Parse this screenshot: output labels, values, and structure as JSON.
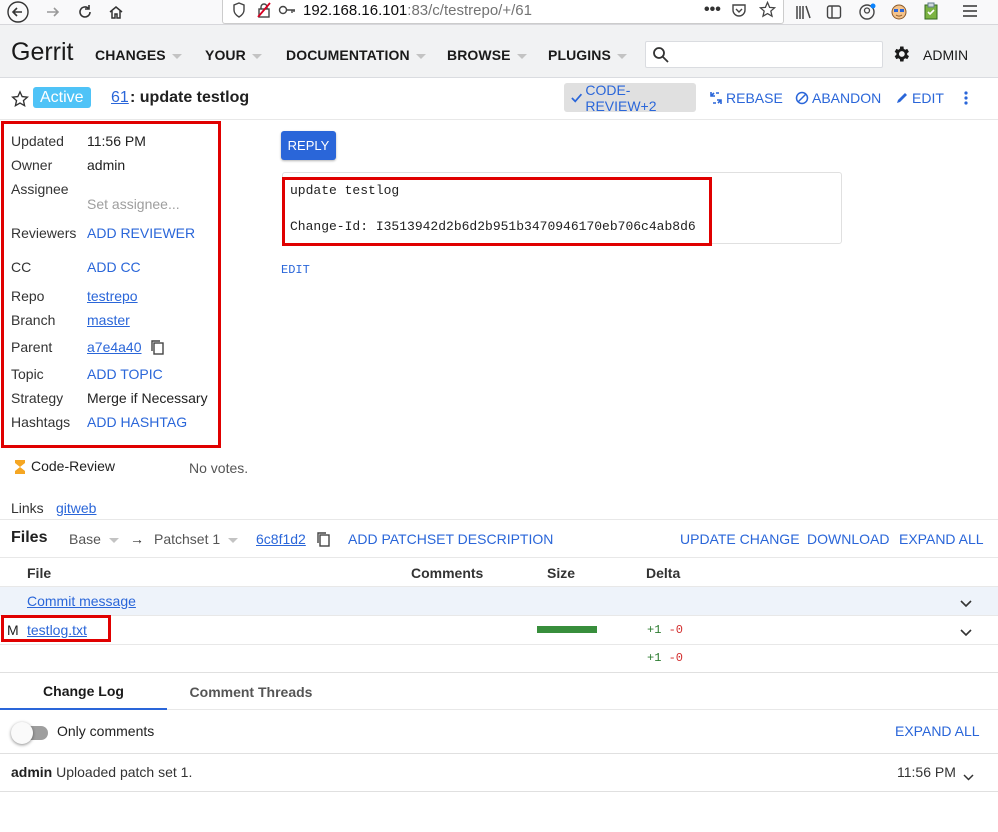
{
  "browser": {
    "url_host": "192.168.16.101",
    "url_rest": ":83/c/testrepo/+/61"
  },
  "header": {
    "logo": "Gerrit",
    "menus": [
      "CHANGES",
      "YOUR",
      "DOCUMENTATION",
      "BROWSE",
      "PLUGINS"
    ],
    "search_placeholder": "",
    "user": "ADMIN"
  },
  "change": {
    "status": "Active",
    "number": "61",
    "title": ": update testlog",
    "actions": {
      "code_review": "CODE-REVIEW+2",
      "rebase": "REBASE",
      "abandon": "ABANDON",
      "edit": "EDIT"
    }
  },
  "meta": {
    "updated_label": "Updated",
    "updated_value": "11:56 PM",
    "owner_label": "Owner",
    "owner_value": "admin",
    "assignee_label": "Assignee",
    "assignee_value": "Set assignee...",
    "reviewers_label": "Reviewers",
    "reviewers_value": "ADD REVIEWER",
    "cc_label": "CC",
    "cc_value": "ADD CC",
    "repo_label": "Repo",
    "repo_value": "testrepo",
    "branch_label": "Branch",
    "branch_value": "master",
    "parent_label": "Parent",
    "parent_value": "a7e4a40",
    "topic_label": "Topic",
    "topic_value": "ADD TOPIC",
    "strategy_label": "Strategy",
    "strategy_value": "Merge if Necessary",
    "hashtags_label": "Hashtags",
    "hashtags_value": "ADD HASHTAG",
    "code_review_label": "Code-Review",
    "code_review_value": "No votes.",
    "links_label": "Links",
    "links_value": "gitweb"
  },
  "message": {
    "reply": "REPLY",
    "line1": "update testlog",
    "line2": "Change-Id: I3513942d2b6d2b951b3470946170eb706c4ab8d6",
    "edit": "EDIT"
  },
  "files": {
    "title": "Files",
    "base": "Base",
    "arrow": "→",
    "patchset": "Patchset 1",
    "commit": "6c8f1d2",
    "add_description": "ADD PATCHSET DESCRIPTION",
    "update_change": "UPDATE CHANGE",
    "download": "DOWNLOAD",
    "expand_all": "EXPAND ALL",
    "columns": [
      "File",
      "Comments",
      "Size",
      "Delta"
    ],
    "commit_message": "Commit message",
    "rows": [
      {
        "status": "M",
        "name": "testlog.txt",
        "added": "+1",
        "removed": "-0",
        "size_fraction": 1.0
      }
    ],
    "total_added": "+1",
    "total_removed": "-0"
  },
  "tabs": [
    "Change Log",
    "Comment Threads"
  ],
  "log": {
    "only_comments": "Only comments",
    "expand_all": "EXPAND ALL",
    "entry_author": "admin",
    "entry_text": "Uploaded patch set 1.",
    "entry_time": "11:56 PM"
  },
  "colors": {
    "accent": "#2a66d9",
    "status_chip": "#4fc3f7",
    "highlight_box": "#e00000",
    "size_bar": "#388e3c"
  }
}
